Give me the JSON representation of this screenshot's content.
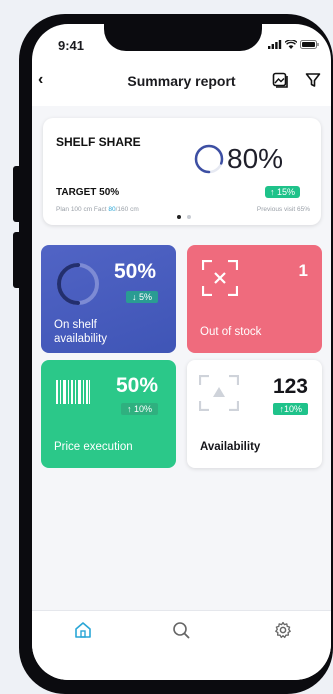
{
  "status": {
    "time": "9:41"
  },
  "header": {
    "back": "‹",
    "title": "Summary report"
  },
  "shelf": {
    "heading": "SHELF SHARE",
    "percent": "80%",
    "target": "TARGET 50%",
    "delta": "↑ 15%",
    "plan_prefix": "Plan 100 cm Fact ",
    "plan_highlight": "80",
    "plan_suffix": "/160 cm",
    "previous": "Previous visit 65%",
    "progress": 0.8
  },
  "tiles": {
    "availability_shelf": {
      "value": "50%",
      "delta": "↓ 5%",
      "label_line1": "On shelf",
      "label_line2": "availability",
      "progress": 0.5
    },
    "out_of_stock": {
      "value": "1",
      "label": "Out of stock"
    },
    "price_execution": {
      "value": "50%",
      "delta": "↑ 10%",
      "label": "Price execution"
    },
    "availability": {
      "value": "123",
      "delta": "↑10%",
      "label": "Availability"
    }
  },
  "colors": {
    "accent": "#2aa6d6",
    "positive": "#1fc28a",
    "shelf_tile": "#4b5fc0",
    "stock_tile": "#ef6b7d",
    "price_tile": "#2bc889"
  },
  "icons": [
    "home-icon",
    "search-icon",
    "settings-icon",
    "gallery-icon",
    "filter-icon"
  ]
}
